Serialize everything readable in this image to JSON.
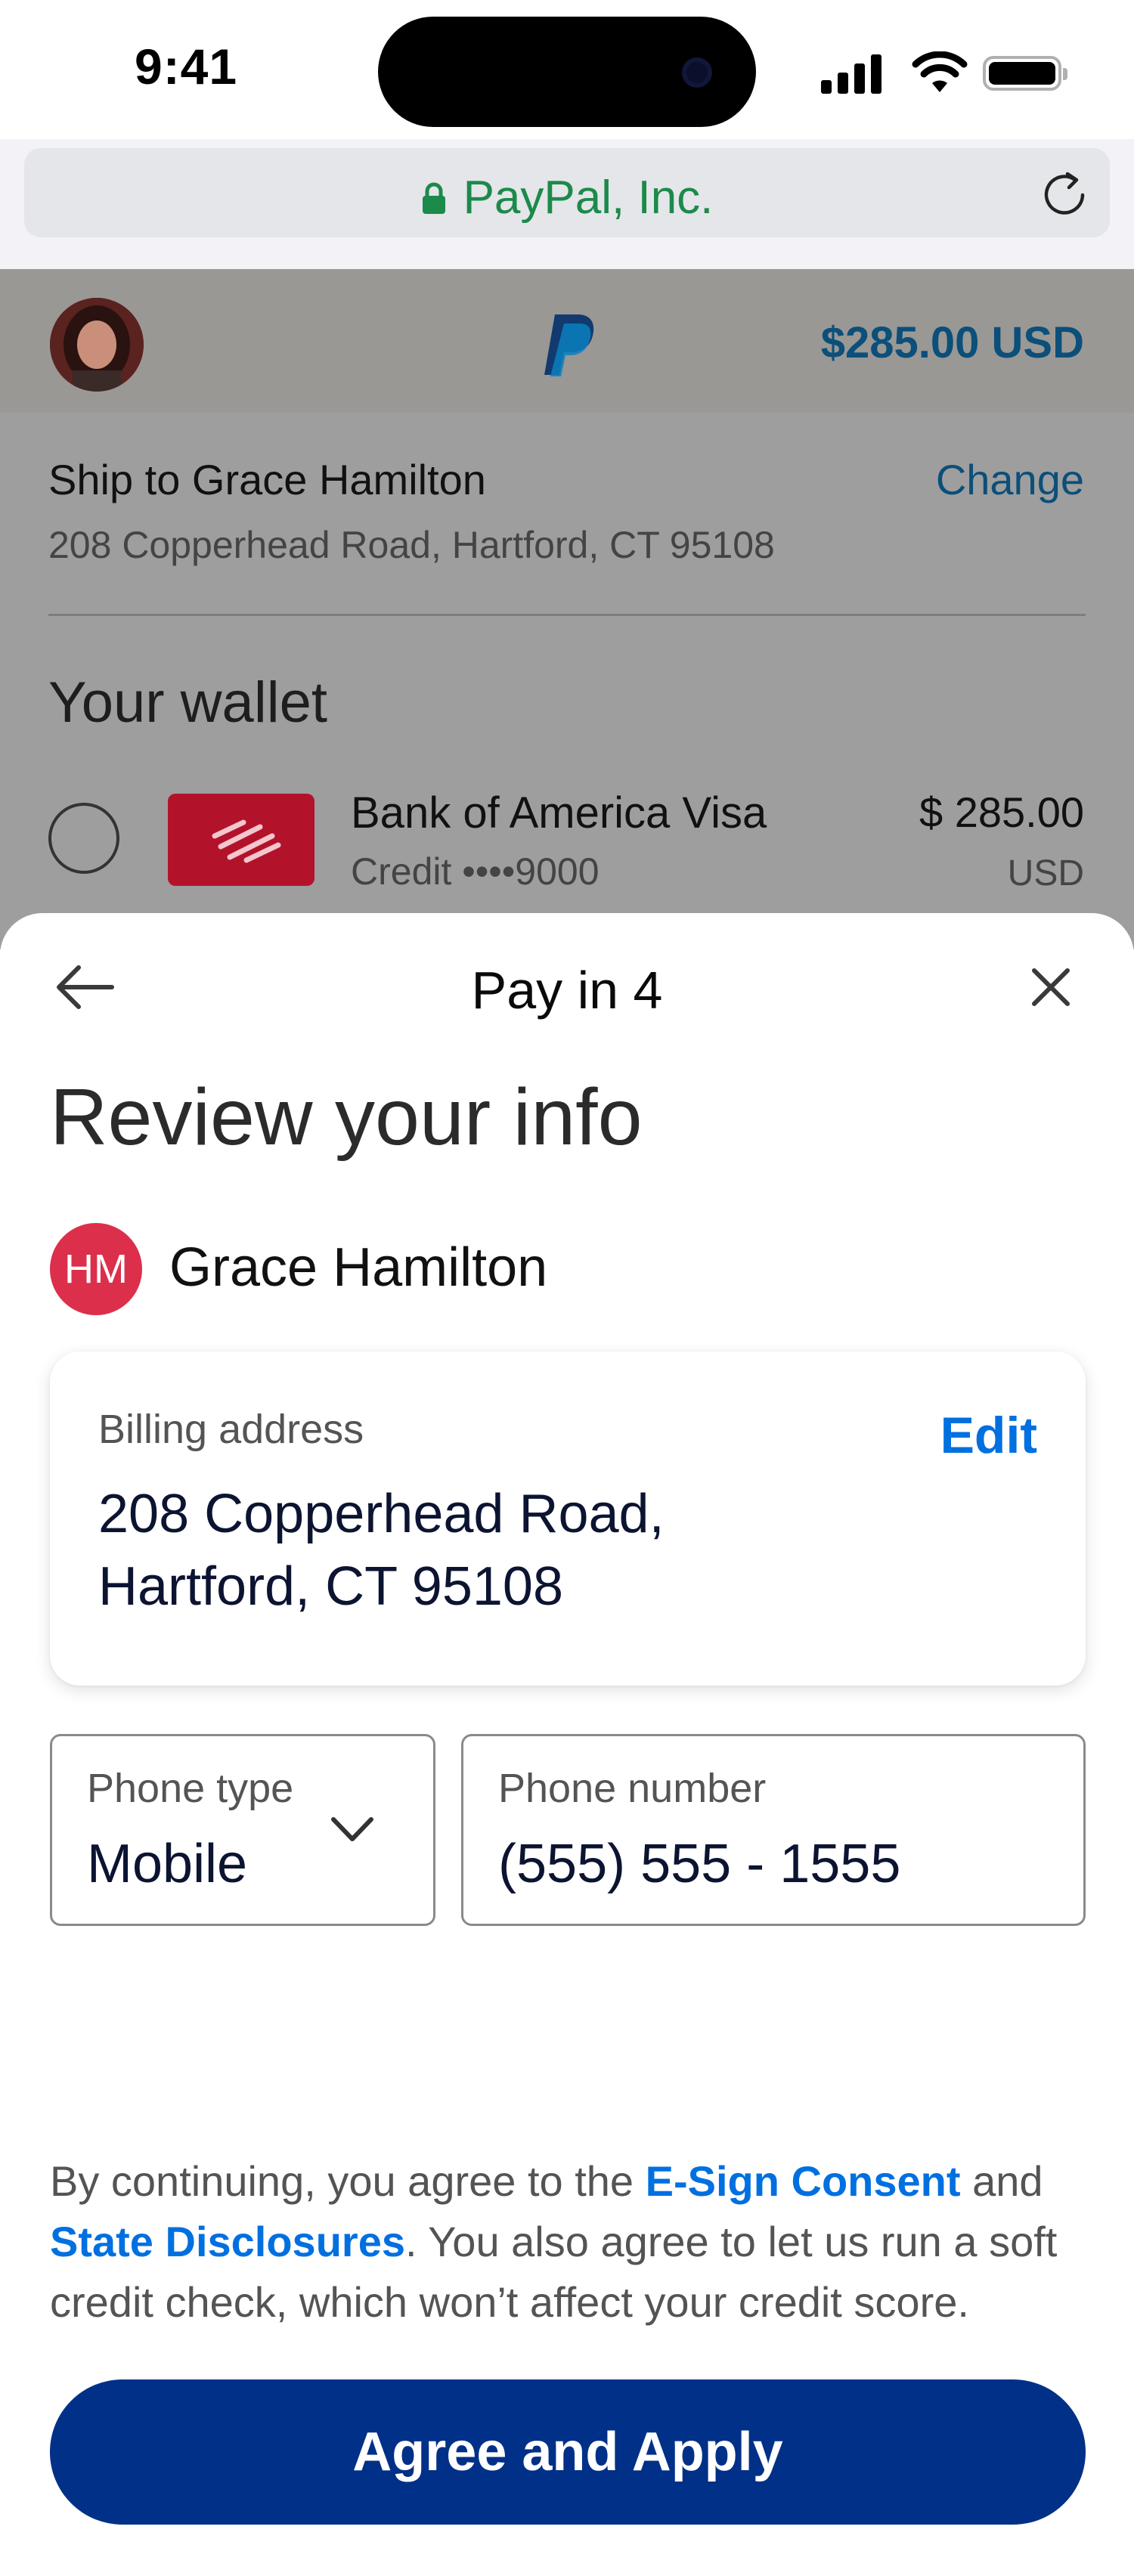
{
  "status_bar": {
    "time": "9:41",
    "icons": [
      "signal-icon",
      "wifi-icon",
      "battery-icon"
    ]
  },
  "browser": {
    "url_label": "PayPal, Inc.",
    "icons": [
      "lock-icon",
      "reload-icon"
    ]
  },
  "background_page": {
    "header": {
      "amount": "$285.00 USD",
      "logo": "paypal-logo"
    },
    "shipping": {
      "label": "Ship to Grace Hamilton",
      "change": "Change",
      "address": "208 Copperhead Road, Hartford, CT 95108"
    },
    "wallet": {
      "title": "Your wallet",
      "card_name": "Bank of America Visa",
      "card_sub": "Credit ••••9000",
      "card_amount": "$ 285.00",
      "card_currency": "USD"
    }
  },
  "sheet": {
    "title": "Pay in 4",
    "heading": "Review your info",
    "user": {
      "initials": "HM",
      "name": "Grace Hamilton"
    },
    "billing": {
      "label": "Billing address",
      "edit": "Edit",
      "line1": "208 Copperhead Road,",
      "line2": "Hartford, CT 95108"
    },
    "phone_type": {
      "label": "Phone type",
      "value": "Mobile"
    },
    "phone_number": {
      "label": "Phone number",
      "value": "(555) 555 - 1555"
    },
    "legal": {
      "part1": "By continuing, you agree to the ",
      "link1": "E-Sign Consent",
      "part2": " and ",
      "link2": "State Disclosures",
      "part3": ". You also agree to let us run a soft credit check, which won’t affect your credit score."
    },
    "agree_button": "Agree and Apply"
  },
  "colors": {
    "primary_button": "#003087",
    "link": "#0070e0",
    "badge": "#dc2f4c",
    "secure_url": "#1c8a4a",
    "overlay_amount": "#0b4f7a"
  }
}
